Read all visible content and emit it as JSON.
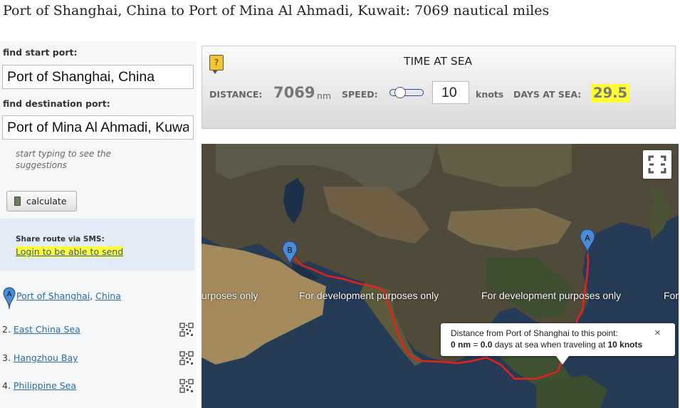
{
  "page": {
    "title": "Port of Shanghai, China to Port of Mina Al Ahmadi, Kuwait: 7069 nautical miles"
  },
  "search": {
    "start_label": "find start port:",
    "start_value": "Port of Shanghai, China",
    "dest_label": "find destination port:",
    "dest_value": "Port of Mina Al Ahmadi, Kuwai",
    "hint": "start typing to see the suggestions",
    "calculate_label": "calculate"
  },
  "sms": {
    "label": "Share route via SMS:",
    "link": "Login to be able to send"
  },
  "route": {
    "first": {
      "pin": "A",
      "name": "Port of Shanghai",
      "sep": ", ",
      "country": "China"
    },
    "items": [
      {
        "num": "2.",
        "name": "East China Sea",
        "icon": "qr-code-icon"
      },
      {
        "num": "3.",
        "name": "Hangzhou Bay",
        "icon": "qr-code-icon"
      },
      {
        "num": "4.",
        "name": "Philippine Sea",
        "icon": "qr-code-icon"
      }
    ]
  },
  "panel": {
    "help_icon": "?",
    "title": "TIME AT SEA",
    "distance_label": "DISTANCE:",
    "distance_value": "7069",
    "distance_unit": "nm",
    "speed_label": "SPEED:",
    "speed_value": "10",
    "speed_unit": "knots",
    "days_label": "DAYS AT SEA:",
    "days_value": "29.5",
    "highlight_color": "#ffff33"
  },
  "map": {
    "watermark_1": "urposes only",
    "watermark_2": "For development purposes only",
    "watermark_3": "For development purposes only",
    "watermark_4": "For",
    "marker_a": "A",
    "marker_b": "B",
    "route_color": "#e8211b",
    "marker_color": "#4a8bd8",
    "fullscreen_icon": "fullscreen-icon",
    "info": {
      "line1": "Distance from Port of Shanghai to this point:",
      "line2_a": "0 nm",
      "line2_b": " = ",
      "line2_c": "0.0",
      "line2_d": " days at sea when traveling at ",
      "line2_e": "10 knots",
      "close": "×"
    }
  }
}
